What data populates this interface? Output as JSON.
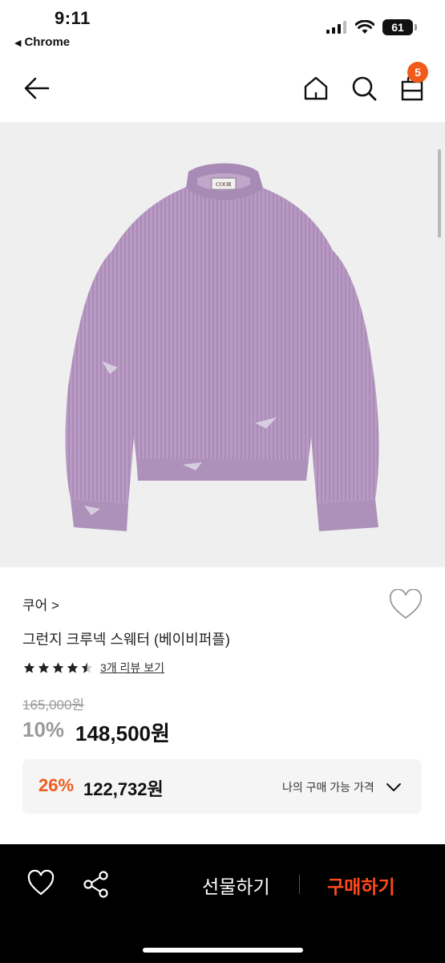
{
  "status_bar": {
    "time": "9:11",
    "back_app": "Chrome",
    "battery": "61"
  },
  "nav": {
    "cart_count": "5",
    "accent_color": "#f05a1a"
  },
  "product": {
    "brand": "쿠어",
    "brand_chevron": ">",
    "title": "그런지 크루넥 스웨터 (베이비퍼플)",
    "image_label": "COOR",
    "rating": 4.5,
    "review_text": "3개 리뷰 보기",
    "original_price": "165,000원",
    "discount_pct": "10%",
    "sale_price": "148,500원"
  },
  "my_price": {
    "discount_pct": "26%",
    "price": "122,732원",
    "label": "나의 구매 가능 가격"
  },
  "bottom_bar": {
    "gift_label": "선물하기",
    "buy_label": "구매하기",
    "buy_color": "#ff4a1a"
  },
  "icons": [
    "back-arrow-icon",
    "home-icon",
    "search-icon",
    "shopping-bag-icon",
    "heart-icon",
    "share-icon",
    "chevron-down-icon",
    "star-icon",
    "signal-icon",
    "wifi-icon",
    "battery-icon"
  ]
}
